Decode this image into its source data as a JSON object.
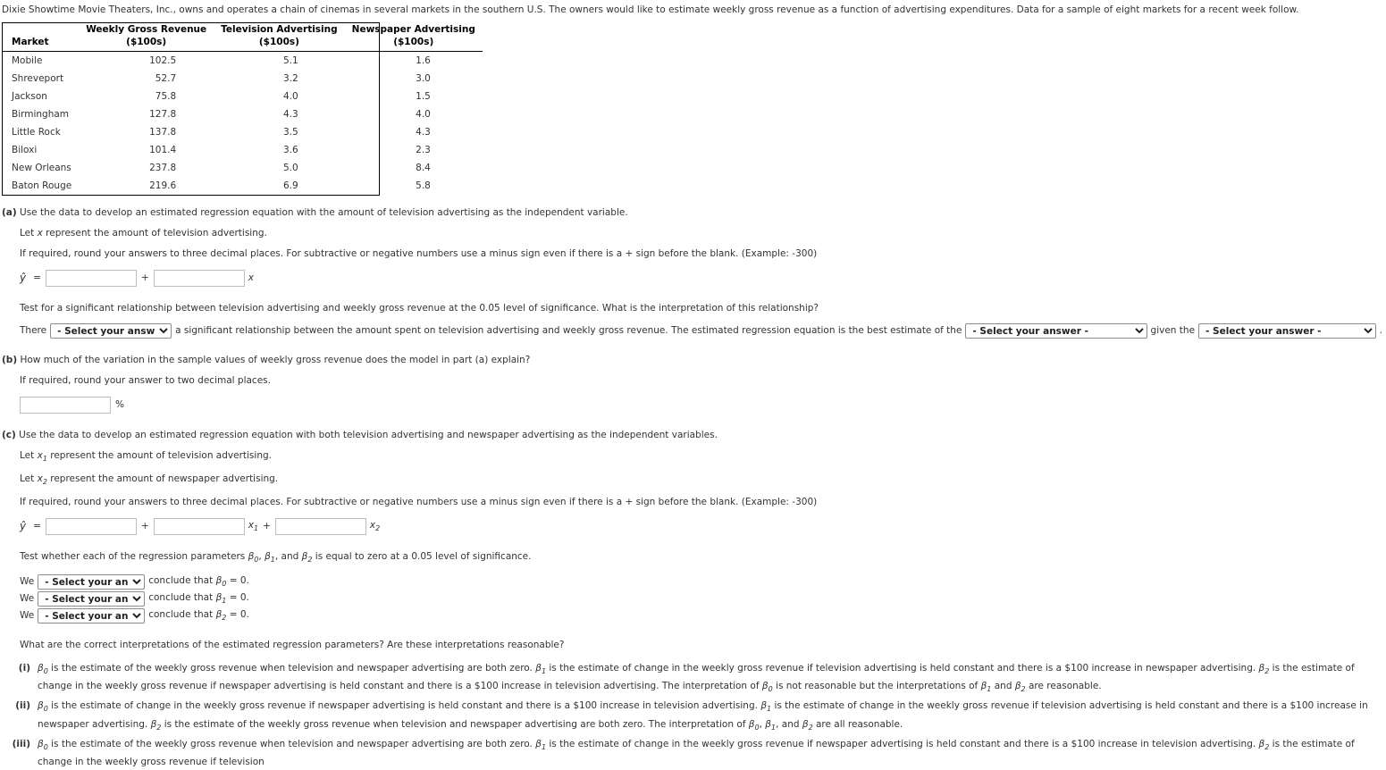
{
  "intro": "Dixie Showtime Movie Theaters, Inc., owns and operates a chain of cinemas in several markets in the southern U.S. The owners would like to estimate weekly gross revenue as a function of advertising expenditures. Data for a sample of eight markets for a recent week follow.",
  "table": {
    "headers_top": [
      "",
      "Weekly Gross Revenue",
      "Television Advertising",
      "Newspaper Advertising"
    ],
    "headers_bottom": [
      "Market",
      "($100s)",
      "($100s)",
      "($100s)"
    ],
    "rows": [
      {
        "market": "Mobile",
        "revenue": "102.5",
        "tv": "5.1",
        "news": "1.6"
      },
      {
        "market": "Shreveport",
        "revenue": "52.7",
        "tv": "3.2",
        "news": "3.0"
      },
      {
        "market": "Jackson",
        "revenue": "75.8",
        "tv": "4.0",
        "news": "1.5"
      },
      {
        "market": "Birmingham",
        "revenue": "127.8",
        "tv": "4.3",
        "news": "4.0"
      },
      {
        "market": "Little Rock",
        "revenue": "137.8",
        "tv": "3.5",
        "news": "4.3"
      },
      {
        "market": "Biloxi",
        "revenue": "101.4",
        "tv": "3.6",
        "news": "2.3"
      },
      {
        "market": "New Orleans",
        "revenue": "237.8",
        "tv": "5.0",
        "news": "8.4"
      },
      {
        "market": "Baton Rouge",
        "revenue": "219.6",
        "tv": "6.9",
        "news": "5.8"
      }
    ]
  },
  "part_a": {
    "label": "(a)",
    "prompt": "Use the data to develop an estimated regression equation with the amount of television advertising as the independent variable.",
    "let_line": "Let x represent the amount of television advertising.",
    "rounding": "If required, round your answers to three decimal places. For subtractive or negative numbers use a minus sign even if there is a + sign before the blank. (Example: -300)",
    "eq_yhat": "ŷ",
    "eq_equals": "=",
    "eq_plus": "+",
    "eq_var_x": "x",
    "intercept_value": "",
    "slope_value": "",
    "test_prompt": "Test for a significant relationship between television advertising and weekly gross revenue at the 0.05 level of significance. What is the interpretation of this relationship?",
    "sentence_there": "There",
    "sentence_mid": "a significant relationship between the amount spent on television advertising and weekly gross revenue. The estimated regression equation is the best estimate of the",
    "sentence_given": "given the",
    "sentence_end": ".",
    "select_placeholder": "- Select your answer -"
  },
  "part_b": {
    "label": "(b)",
    "prompt": "How much of the variation in the sample values of weekly gross revenue does the model in part (a) explain?",
    "rounding": "If required, round your answer to two decimal places.",
    "value": "",
    "unit": "%"
  },
  "part_c": {
    "label": "(c)",
    "prompt": "Use the data to develop an estimated regression equation with both television advertising and newspaper advertising as the independent variables.",
    "let_line_1": "Let x1 represent the amount of television advertising.",
    "let_line_2": "Let x2 represent the amount of newspaper advertising.",
    "rounding": "If required, round your answers to three decimal places. For subtractive or negative numbers use a minus sign even if there is a + sign before the blank. (Example: -300)",
    "eq_yhat": "ŷ",
    "eq_equals": "=",
    "eq_plus_1": "+",
    "eq_plus_2": "+",
    "eq_var_x1": "x",
    "eq_var_x1_sub": "1",
    "eq_var_x2": "x",
    "eq_var_x2_sub": "2",
    "intercept_value": "",
    "b1_value": "",
    "b2_value": "",
    "test_prompt": "Test whether each of the regression parameters β0, β1, and β2 is equal to zero at a 0.05 level of significance.",
    "select_placeholder": "- Select your answer -",
    "we_label": "We",
    "conclusions": [
      "conclude that β0 = 0.",
      "conclude that β1 = 0.",
      "conclude that β2 = 0."
    ],
    "interp_prompt": "What are the correct interpretations of the estimated regression parameters? Are these interpretations reasonable?",
    "interpretations": [
      {
        "roman": "(i)",
        "text": "β0 is the estimate of the weekly gross revenue when television and newspaper advertising are both zero. β1 is the estimate of change in the weekly gross revenue if television advertising is held constant and there is a $100 increase in newspaper advertising. β2 is the estimate of change in the weekly gross revenue if newspaper advertising is held constant and there is a $100 increase in television advertising. The interpretation of β0 is not reasonable but the interpretations of β1 and β2 are reasonable."
      },
      {
        "roman": "(ii)",
        "text": "β0 is the estimate of change in the weekly gross revenue if newspaper advertising is held constant and there is a $100 increase in television advertising. β1 is the estimate of change in the weekly gross revenue if television advertising is held constant and there is a $100 increase in newspaper advertising. β2 is the estimate of the weekly gross revenue when television and newspaper advertising are both zero. The interpretation of β0, β1, and β2 are all reasonable."
      },
      {
        "roman": "(iii)",
        "text": "β0 is the estimate of the weekly gross revenue when television and newspaper advertising are both zero. β1 is the estimate of change in the weekly gross revenue if newspaper advertising is held constant and there is a $100 increase in television advertising. β2 is the estimate of change in the weekly gross revenue if television"
      }
    ]
  }
}
